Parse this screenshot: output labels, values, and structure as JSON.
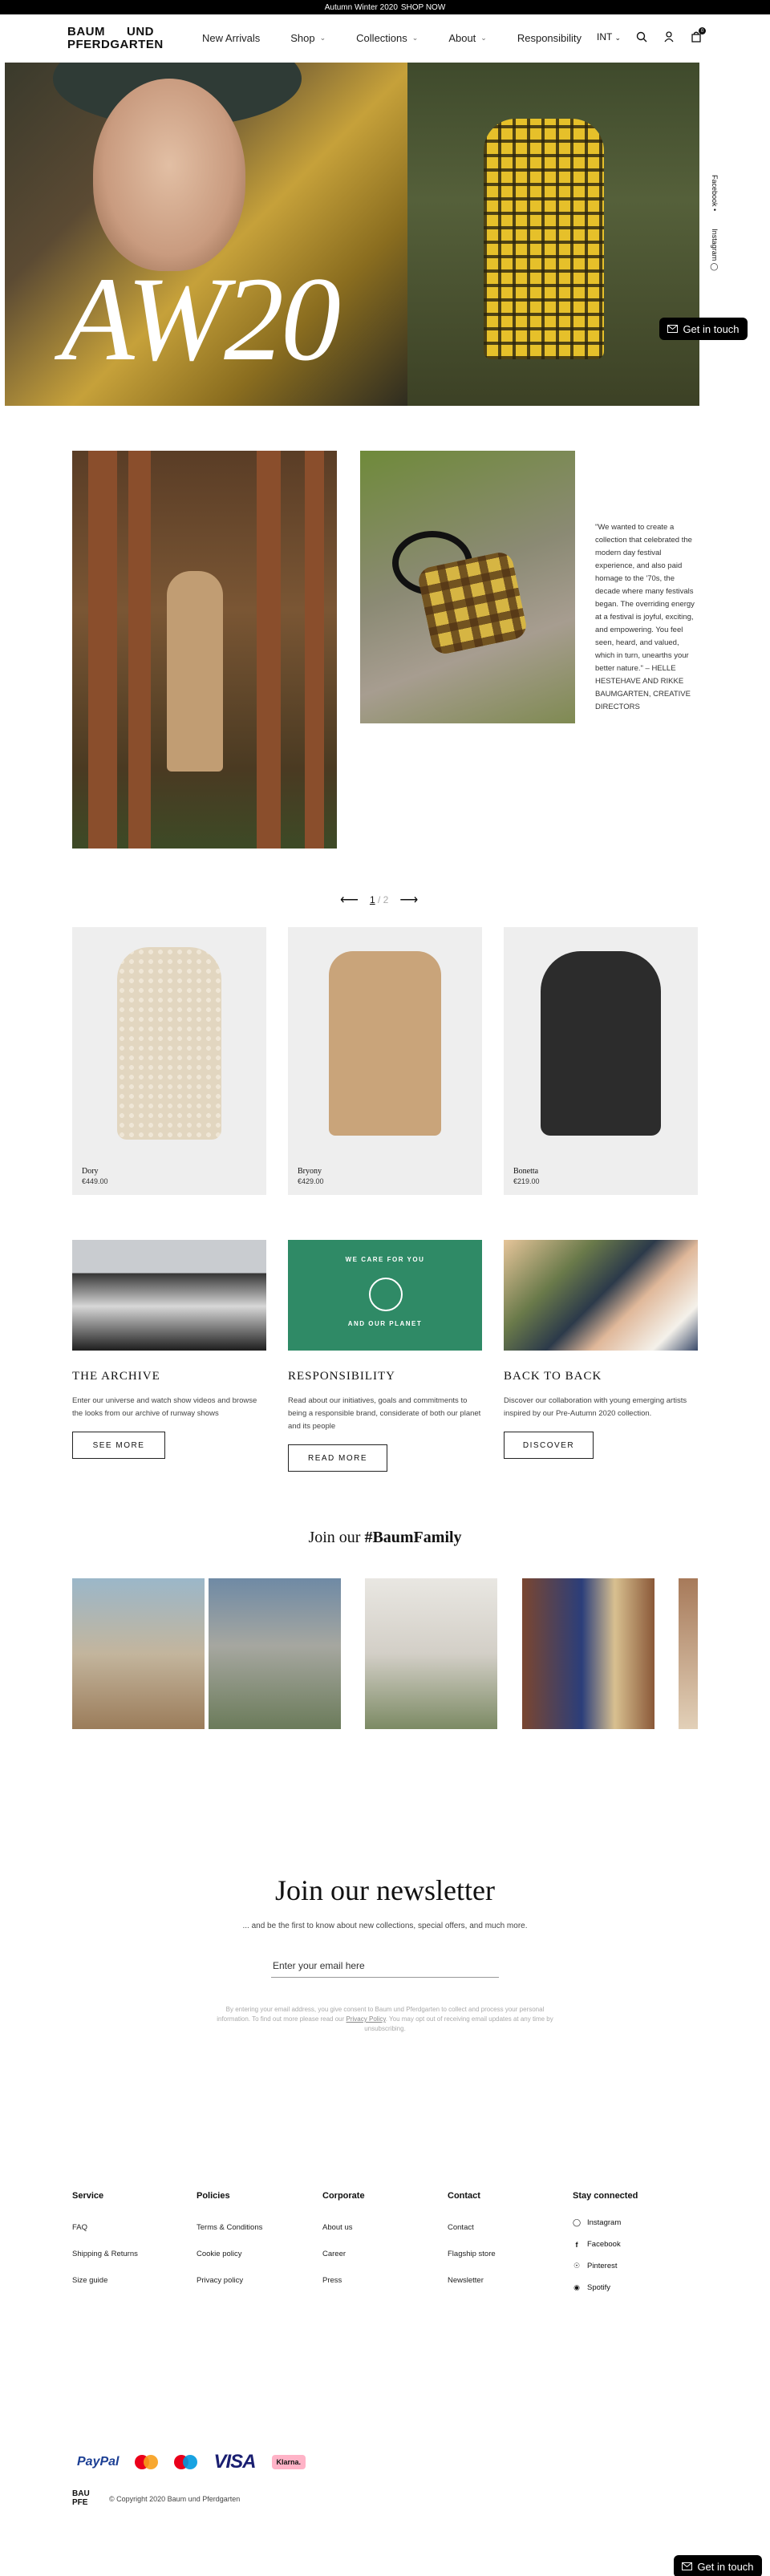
{
  "announcement": {
    "text": "Autumn Winter 2020",
    "link": "SHOP NOW"
  },
  "logo": {
    "line1a": "BAUM",
    "line1b": "UND",
    "line2": "PFERDGARTEN"
  },
  "nav": {
    "items": [
      {
        "label": "New Arrivals",
        "has_menu": false
      },
      {
        "label": "Shop",
        "has_menu": true
      },
      {
        "label": "Collections",
        "has_menu": true
      },
      {
        "label": "About",
        "has_menu": true
      },
      {
        "label": "Responsibility",
        "has_menu": false
      }
    ],
    "currency": "INT",
    "cart_count": "0"
  },
  "hero": {
    "title": "AW20"
  },
  "social_rail": {
    "facebook": "Facebook",
    "instagram": "Instagram"
  },
  "get_in_touch": "Get in touch",
  "quote": "\"We wanted to create a collection that celebrated the modern day festival experience, and also paid homage to the '70s, the decade where many festivals began. The overriding energy at a festival is joyful, exciting, and empowering. You feel seen, heard, and valued, which in turn, unearths your better nature.\" – HELLE HESTEHAVE AND RIKKE BAUMGARTEN, CREATIVE DIRECTORS",
  "pager": {
    "current": "1",
    "total": "2"
  },
  "products": [
    {
      "name": "Dory",
      "price": "€449.00"
    },
    {
      "name": "Bryony",
      "price": "€429.00"
    },
    {
      "name": "Bonetta",
      "price": "€219.00"
    }
  ],
  "features": [
    {
      "title": "THE ARCHIVE",
      "text": "Enter our universe and watch show videos and browse the looks from our archive of runway shows",
      "button": "SEE MORE"
    },
    {
      "title": "RESPONSIBILITY",
      "text": "Read about our initiatives, goals and commitments to being a responsible brand, considerate of both our planet and its people",
      "button": "READ MORE",
      "img_text1": "WE CARE FOR YOU",
      "img_text2": "AND OUR PLANET"
    },
    {
      "title": "BACK TO BACK",
      "text": "Discover our collaboration with young emerging artists inspired by our Pre-Autumn 2020 collection.",
      "button": "DISCOVER"
    }
  ],
  "family": {
    "prefix": "Join our",
    "hashtag": "#BaumFamily"
  },
  "newsletter": {
    "title": "Join our newsletter",
    "subtitle": "... and be the first to know about new collections, special offers, and much more.",
    "placeholder": "Enter your email here",
    "legal_pre": "By entering your email address, you give consent to Baum und Pferdgarten to collect and process your personal information. To find out more please read our",
    "legal_link": "Privacy Policy",
    "legal_post": ". You may opt out of receiving email updates at any time by unsubscribing."
  },
  "footer": {
    "service": {
      "title": "Service",
      "links": [
        "FAQ",
        "Shipping & Returns",
        "Size guide"
      ]
    },
    "policies": {
      "title": "Policies",
      "links": [
        "Terms & Conditions",
        "Cookie policy",
        "Privacy policy"
      ]
    },
    "corporate": {
      "title": "Corporate",
      "links": [
        "About us",
        "Career",
        "Press"
      ]
    },
    "contact": {
      "title": "Contact",
      "links": [
        "Contact",
        "Flagship store",
        "Newsletter"
      ]
    },
    "social": {
      "title": "Stay connected",
      "links": [
        "Instagram",
        "Facebook",
        "Pinterest",
        "Spotify"
      ]
    }
  },
  "payments": {
    "paypal": "PayPal",
    "visa": "VISA",
    "klarna": "Klarna."
  },
  "footer_logo": {
    "line1": "BAU",
    "line2": "PFE"
  },
  "copyright": "© Copyright 2020 Baum und Pferdgarten",
  "colors": {
    "accent": "#000000",
    "responsibility_green": "#2f8a66",
    "klarna_pink": "#ffb3c7"
  }
}
